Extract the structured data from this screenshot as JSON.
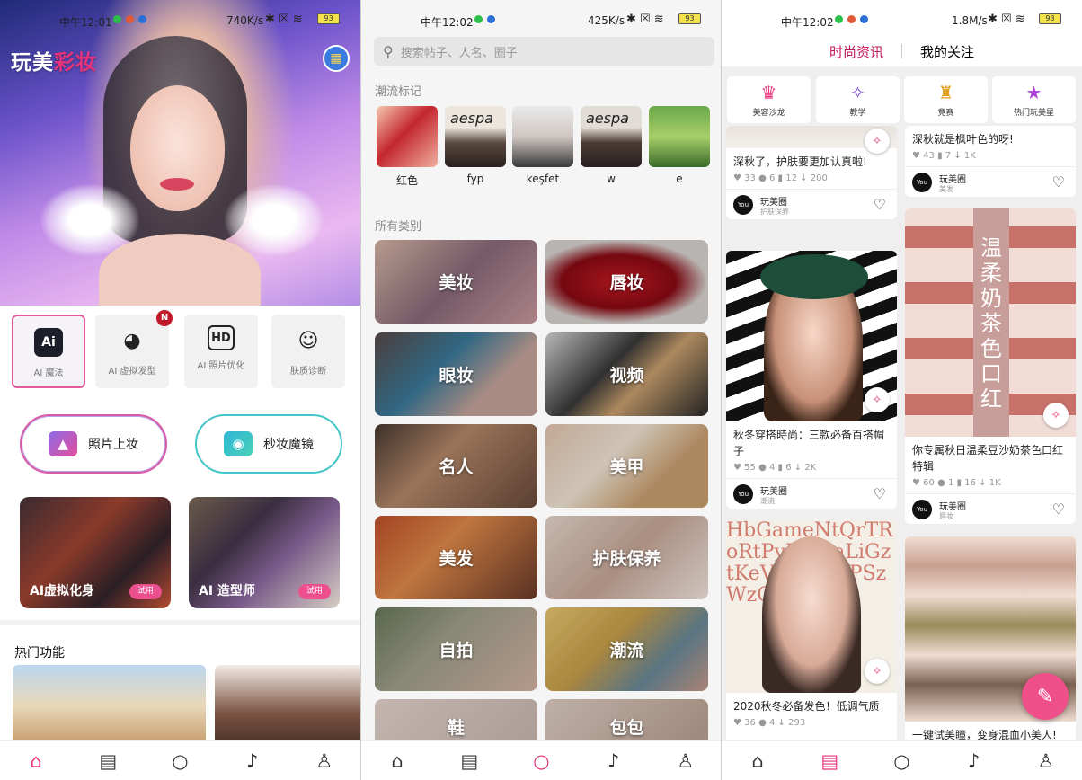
{
  "screen1": {
    "status": {
      "time": "中午12:01",
      "speed": "740K/s",
      "battery": "93"
    },
    "app_title_a": "玩美",
    "app_title_b": "彩妆",
    "features": [
      {
        "label": "AI 魔法",
        "icon": "ai-magic-icon"
      },
      {
        "label": "AI 虚拟发型",
        "icon": "hair-icon",
        "badge": "N"
      },
      {
        "label": "AI 照片优化",
        "icon": "hd-icon"
      },
      {
        "label": "肤质诊断",
        "icon": "skin-face-icon"
      }
    ],
    "photo_makeup": "照片上妆",
    "instant_mirror": "秒妆魔镜",
    "cards": [
      {
        "label": "AI虚拟化身",
        "try": "试用"
      },
      {
        "label": "AI 造型师",
        "try": "试用"
      }
    ],
    "hot_features": "热门功能"
  },
  "screen2": {
    "status": {
      "time": "中午12:02",
      "speed": "425K/s",
      "battery": "93"
    },
    "search_placeholder": "搜索帖子、人名、圈子",
    "trend_label": "潮流标记",
    "trends": [
      "红色",
      "fyp",
      "keşfet",
      "w",
      "e"
    ],
    "all_label": "所有类别",
    "categories": [
      "美妆",
      "唇妆",
      "眼妆",
      "视频",
      "名人",
      "美甲",
      "美发",
      "护肤保养",
      "自拍",
      "潮流",
      "鞋",
      "包包"
    ]
  },
  "screen3": {
    "status": {
      "time": "中午12:02",
      "speed": "1.8M/s",
      "battery": "93"
    },
    "tabs": [
      "时尚资讯",
      "我的关注"
    ],
    "quick": [
      "美容沙龙",
      "教学",
      "竞赛",
      "热门玩美星"
    ],
    "posts_left": [
      {
        "title": "深秋了，护肤要更加认真啦!",
        "likes": "33",
        "comments": "6",
        "saves": "12",
        "downloads": "200",
        "user": "玩美圈",
        "tag": "护肤保养"
      },
      {
        "title": "秋冬穿搭時尚：三款必备百搭帽子",
        "likes": "55",
        "comments": "4",
        "saves": "6",
        "downloads": "2K",
        "user": "玩美圈",
        "tag": "潮流"
      },
      {
        "title": "2020秋冬必备发色！低调气质",
        "likes": "36",
        "comments": "4",
        "saves": "",
        "downloads": "293"
      }
    ],
    "posts_right": [
      {
        "title": "深秋就是枫叶色的呀!",
        "likes": "43",
        "comments": "",
        "saves": "7",
        "downloads": "1K",
        "user": "玩美圈",
        "tag": "美发"
      },
      {
        "title": "你专属秋日温柔豆沙奶茶色口红特辑",
        "likes": "60",
        "comments": "1",
        "saves": "16",
        "downloads": "1K",
        "user": "玩美圈",
        "tag": "唇妆",
        "overlay": "温柔奶茶色口红"
      },
      {
        "title": "一键试美瞳，变身混血小美人!"
      }
    ],
    "avatar_text": "You Cam"
  },
  "tabbar_icons": [
    "home-icon",
    "news-icon",
    "search-icon",
    "bell-icon",
    "profile-icon"
  ]
}
